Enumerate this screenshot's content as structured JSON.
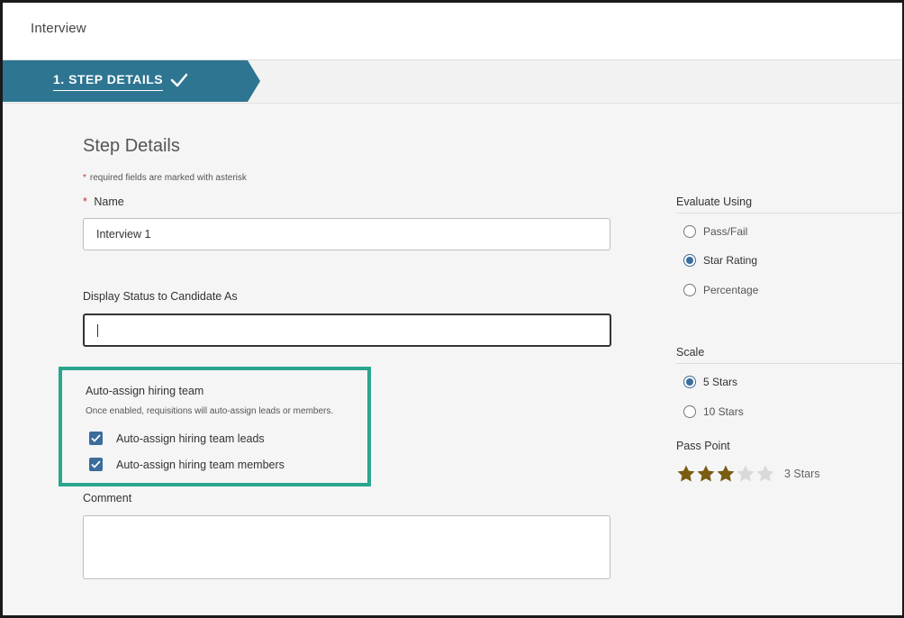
{
  "header": {
    "title": "Interview"
  },
  "step": {
    "label": "1. STEP DETAILS"
  },
  "form": {
    "section_title": "Step Details",
    "required_note": "required fields are marked with asterisk",
    "name_label": "Name",
    "name_value": "Interview 1",
    "display_status_label": "Display Status to Candidate As",
    "display_status_value": "",
    "auto_assign": {
      "title": "Auto-assign hiring team",
      "description": "Once enabled, requisitions will auto-assign leads or members.",
      "leads_label": "Auto-assign hiring team leads",
      "leads_checked": true,
      "members_label": "Auto-assign hiring team members",
      "members_checked": true
    },
    "comment_label": "Comment",
    "comment_value": ""
  },
  "evaluate": {
    "title": "Evaluate Using",
    "options": [
      "Pass/Fail",
      "Star Rating",
      "Percentage"
    ],
    "selected": "Star Rating"
  },
  "scale": {
    "title": "Scale",
    "options": [
      "5 Stars",
      "10 Stars"
    ],
    "selected": "5 Stars"
  },
  "pass_point": {
    "title": "Pass Point",
    "value": 3,
    "max": 5,
    "label": "3 Stars"
  },
  "colors": {
    "step_tab": "#2e7591",
    "highlight": "#2aa58e",
    "checkbox": "#3a6c9c",
    "star_filled": "#7a5c12",
    "star_empty": "#d9d9d9"
  }
}
